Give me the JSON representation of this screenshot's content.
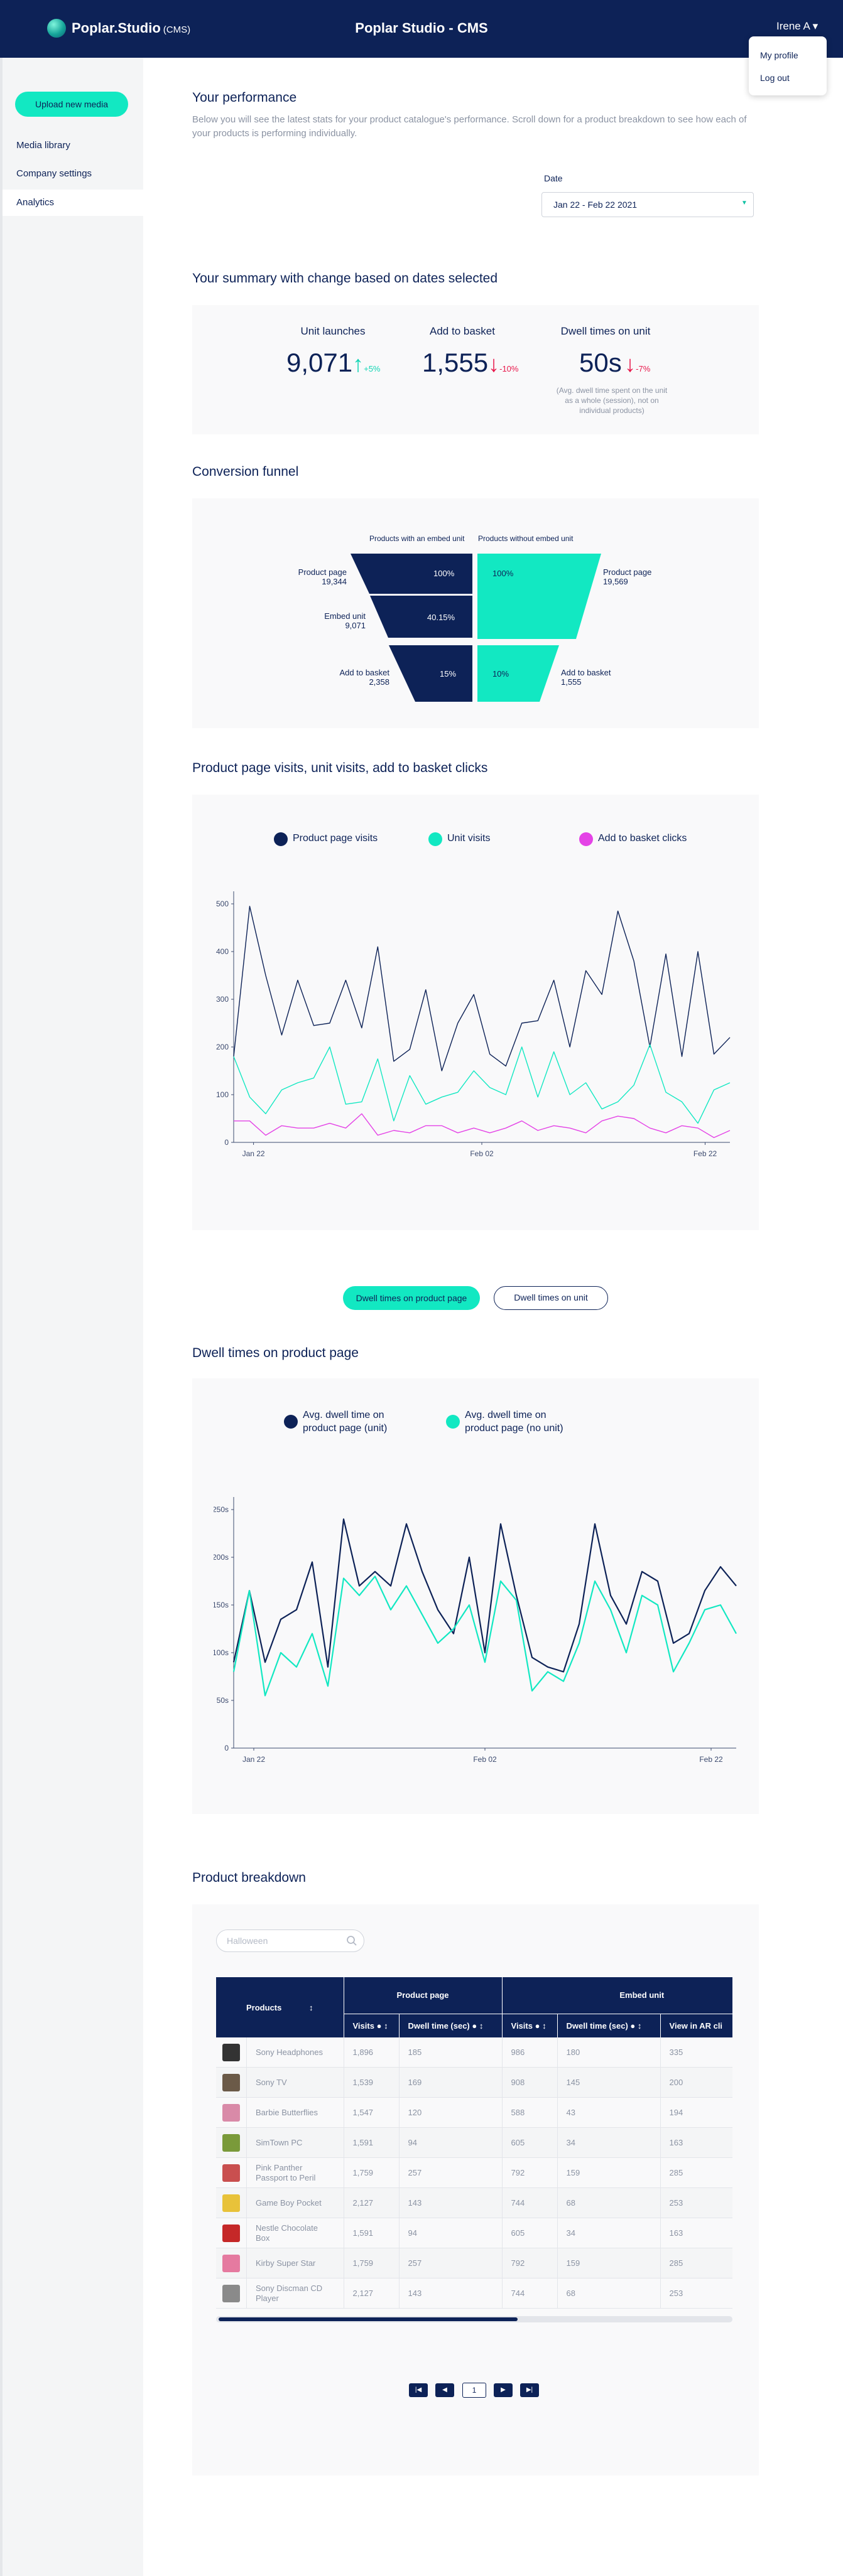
{
  "header": {
    "brand_main": "Poplar.Studio",
    "brand_sub": "(CMS)",
    "title": "Poplar Studio - CMS",
    "user": "Irene A",
    "user_caret": "▾"
  },
  "user_menu": {
    "profile": "My profile",
    "logout": "Log out"
  },
  "sidebar": {
    "upload": "Upload new media",
    "items": [
      {
        "label": "Media library"
      },
      {
        "label": "Company settings"
      },
      {
        "label": "Analytics"
      }
    ]
  },
  "performance": {
    "title": "Your performance",
    "intro": "Below you will see the latest stats for your product catalogue's performance. Scroll down for a product breakdown to see how each of your products is performing individually.",
    "date_label": "Date",
    "date_value": "Jan 22 - Feb 22 2021"
  },
  "summary": {
    "title": "Your summary with change based on dates selected",
    "stats": [
      {
        "label": "Unit launches",
        "value": "9,071",
        "arrow": "↑",
        "delta": "+5%",
        "dir": "up"
      },
      {
        "label": "Add to basket",
        "value": "1,555",
        "arrow": "↓",
        "delta": "-10%",
        "dir": "down"
      },
      {
        "label": "Dwell times on unit",
        "value": "50s",
        "arrow": "↓",
        "delta": "-7%",
        "dir": "down"
      }
    ],
    "note": "(Avg. dwell time spent on the unit as a whole (session), not on individual products)"
  },
  "funnel": {
    "title": "Conversion funnel",
    "with_header": "Products with an embed unit",
    "without_header": "Products without embed unit",
    "left_rows": [
      {
        "label": "Product page",
        "value": "19,344",
        "pct": "100%"
      },
      {
        "label": "Embed unit",
        "value": "9,071",
        "pct": "40.15%"
      },
      {
        "label": "Add to basket",
        "value": "2,358",
        "pct": "15%"
      }
    ],
    "right_rows": [
      {
        "label": "Product page",
        "value": "19,569",
        "pct": "100%"
      },
      {
        "label": "Add to basket",
        "value": "1,555",
        "pct": "10%"
      }
    ]
  },
  "visits_chart": {
    "title": "Product page visits, unit visits, add to basket clicks",
    "chart_data": {
      "type": "line",
      "title": "Product page visits, unit visits, add to basket clicks",
      "x_ticks": [
        "Jan 22",
        "Feb 02",
        "Feb 22"
      ],
      "ylim": [
        0,
        500
      ],
      "y_ticks": [
        0,
        100,
        200,
        300,
        400,
        500
      ],
      "series": [
        {
          "name": "Product page visits",
          "color": "#0d2257",
          "values": [
            180,
            495,
            350,
            225,
            340,
            245,
            250,
            340,
            240,
            410,
            170,
            195,
            320,
            150,
            250,
            310,
            185,
            160,
            250,
            255,
            340,
            200,
            360,
            310,
            485,
            380,
            200,
            395,
            180,
            400,
            185,
            220
          ]
        },
        {
          "name": "Unit visits",
          "color": "#12e8c2",
          "values": [
            180,
            95,
            60,
            110,
            125,
            135,
            200,
            80,
            85,
            175,
            45,
            140,
            80,
            95,
            105,
            150,
            115,
            100,
            200,
            95,
            190,
            100,
            125,
            70,
            85,
            120,
            205,
            105,
            85,
            40,
            110,
            125
          ]
        },
        {
          "name": "Add to basket clicks",
          "color": "#e443e6",
          "values": [
            45,
            45,
            15,
            35,
            30,
            30,
            40,
            30,
            60,
            15,
            25,
            20,
            35,
            35,
            20,
            30,
            20,
            30,
            45,
            25,
            35,
            30,
            20,
            45,
            55,
            50,
            30,
            20,
            35,
            30,
            10,
            25
          ]
        }
      ]
    }
  },
  "toggle": {
    "page": "Dwell times on product page",
    "unit": "Dwell times on unit"
  },
  "dwell_chart": {
    "title": "Dwell times on product page",
    "chart_data": {
      "type": "line",
      "title": "Dwell times on product page",
      "x_ticks": [
        "Jan 22",
        "Feb 02",
        "Feb 22"
      ],
      "ylim": [
        0,
        250
      ],
      "y_ticks": [
        0,
        50,
        100,
        150,
        200,
        250
      ],
      "y_unit": "s",
      "series": [
        {
          "name": "Avg. dwell time on product page (unit)",
          "color": "#0d2257",
          "values": [
            90,
            165,
            90,
            135,
            145,
            195,
            85,
            240,
            170,
            185,
            170,
            235,
            185,
            145,
            120,
            200,
            100,
            235,
            160,
            95,
            85,
            80,
            130,
            235,
            160,
            130,
            185,
            175,
            110,
            120,
            165,
            190,
            170
          ]
        },
        {
          "name": "Avg. dwell time on product page (no unit)",
          "color": "#12e8c2",
          "values": [
            80,
            165,
            55,
            100,
            85,
            120,
            65,
            178,
            160,
            180,
            145,
            170,
            140,
            110,
            125,
            150,
            90,
            175,
            155,
            60,
            80,
            70,
            110,
            175,
            145,
            100,
            160,
            150,
            80,
            110,
            145,
            150,
            120
          ]
        }
      ]
    }
  },
  "breakdown": {
    "title": "Product breakdown",
    "search_placeholder": "Halloween",
    "headers": {
      "products": "Products",
      "sort": "↕",
      "product_page": "Product page",
      "embed_unit": "Embed unit",
      "visits": "Visits",
      "dwell": "Dwell time (sec)",
      "view_ar": "View in AR cli",
      "info": "●"
    },
    "rows": [
      {
        "name": "Sony Headphones",
        "pv": "1,896",
        "pd": "185",
        "uv": "986",
        "ud": "180",
        "ar": "335",
        "icon": "headphones-icon"
      },
      {
        "name": "Sony TV",
        "pv": "1,539",
        "pd": "169",
        "uv": "908",
        "ud": "145",
        "ar": "200",
        "icon": "tv-icon"
      },
      {
        "name": "Barbie Butterflies",
        "pv": "1,547",
        "pd": "120",
        "uv": "588",
        "ud": "43",
        "ar": "194",
        "icon": "barbie-icon"
      },
      {
        "name": "SimTown PC",
        "pv": "1,591",
        "pd": "94",
        "uv": "605",
        "ud": "34",
        "ar": "163",
        "icon": "simtown-icon"
      },
      {
        "name": "Pink Panther Passport to Peril",
        "pv": "1,759",
        "pd": "257",
        "uv": "792",
        "ud": "159",
        "ar": "285",
        "icon": "pink-panther-icon"
      },
      {
        "name": "Game Boy Pocket",
        "pv": "2,127",
        "pd": "143",
        "uv": "744",
        "ud": "68",
        "ar": "253",
        "icon": "gameboy-icon"
      },
      {
        "name": "Nestle Chocolate Box",
        "pv": "1,591",
        "pd": "94",
        "uv": "605",
        "ud": "34",
        "ar": "163",
        "icon": "chocolate-icon"
      },
      {
        "name": "Kirby Super Star",
        "pv": "1,759",
        "pd": "257",
        "uv": "792",
        "ud": "159",
        "ar": "285",
        "icon": "kirby-icon"
      },
      {
        "name": "Sony Discman CD Player",
        "pv": "2,127",
        "pd": "143",
        "uv": "744",
        "ud": "68",
        "ar": "253",
        "icon": "discman-icon"
      }
    ],
    "pagination": {
      "first": "|◀",
      "prev": "◀",
      "page": "1",
      "next": "▶",
      "last": "▶|"
    }
  },
  "colors": {
    "navy": "#0d2257",
    "teal": "#12e8c2",
    "pink": "#e443e6",
    "red": "#e8184b"
  }
}
